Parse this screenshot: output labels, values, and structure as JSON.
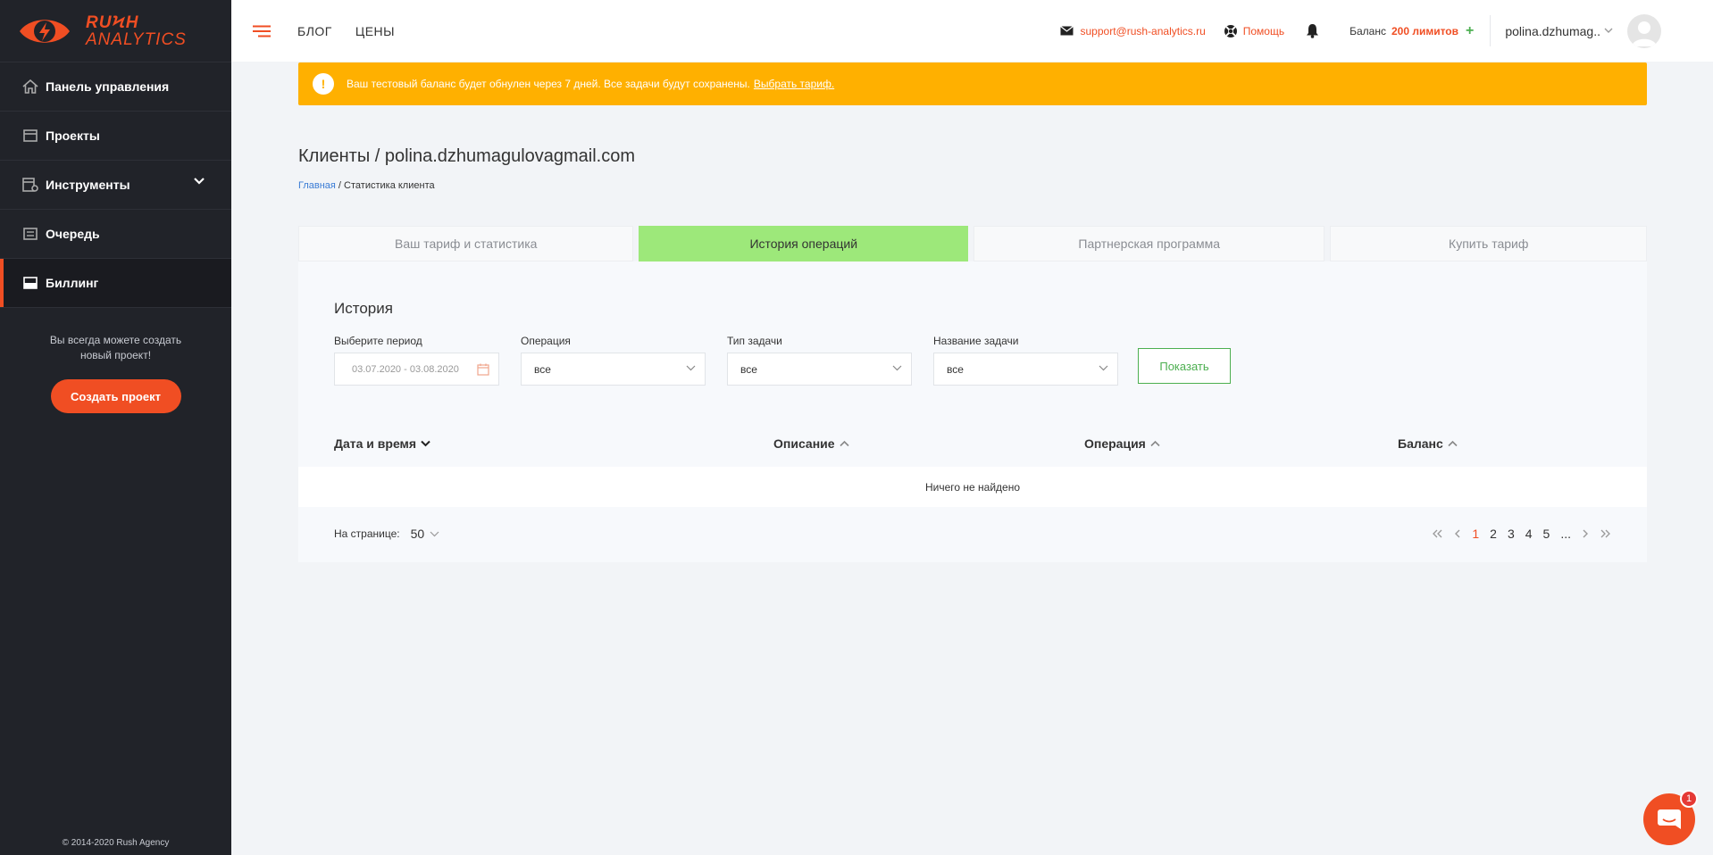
{
  "brand": {
    "line1": "RUϞH",
    "line2": "ANALYTICS",
    "accent": "#f04e23"
  },
  "sidebar": {
    "items": [
      {
        "label": "Панель управления",
        "icon": "home-icon"
      },
      {
        "label": "Проекты",
        "icon": "projects-icon"
      },
      {
        "label": "Инструменты",
        "icon": "tools-icon"
      },
      {
        "label": "Очередь",
        "icon": "queue-icon"
      },
      {
        "label": "Биллинг",
        "icon": "billing-icon",
        "active": true
      }
    ],
    "note": "Вы всегда можете создать новый проект!",
    "create_button": "Создать проект",
    "copyright": "© 2014-2020 Rush Agency"
  },
  "header": {
    "links": [
      "БЛОГ",
      "ЦЕНЫ"
    ],
    "support_email": "support@rush-analytics.ru",
    "help": "Помощь",
    "balance_label": "Баланс",
    "balance_value": "200 лимитов",
    "balance_plus": "+",
    "user": "polina.dzhumag.."
  },
  "alert": {
    "icon": "!",
    "text": "Ваш тестовый баланс будет обнулен через 7 дней. Все задачи будут сохранены.",
    "link": "Выбрать тариф."
  },
  "page": {
    "title": "Клиенты / polina.dzhumagulovagmail.com",
    "breadcrumb_home": "Главная",
    "breadcrumb_sep": " / ",
    "breadcrumb_current": "Статистика клиента"
  },
  "tabs": [
    "Ваш тариф и статистика",
    "История операций",
    "Партнерская программа",
    "Купить тариф"
  ],
  "history": {
    "title": "История",
    "filters": {
      "period_label": "Выберите период",
      "period_value": "03.07.2020 - 03.08.2020",
      "operation_label": "Операция",
      "operation_value": "все",
      "task_type_label": "Тип задачи",
      "task_type_value": "все",
      "task_name_label": "Название задачи",
      "task_name_value": "все"
    },
    "show_button": "Показать",
    "columns": [
      "Дата и время",
      "Описание",
      "Операция",
      "Баланс"
    ],
    "empty": "Ничего не найдено",
    "per_page_label": "На странице:",
    "per_page_value": "50",
    "pages": [
      "1",
      "2",
      "3",
      "4",
      "5",
      "..."
    ],
    "current_page": "1"
  },
  "chat_badge": "1"
}
